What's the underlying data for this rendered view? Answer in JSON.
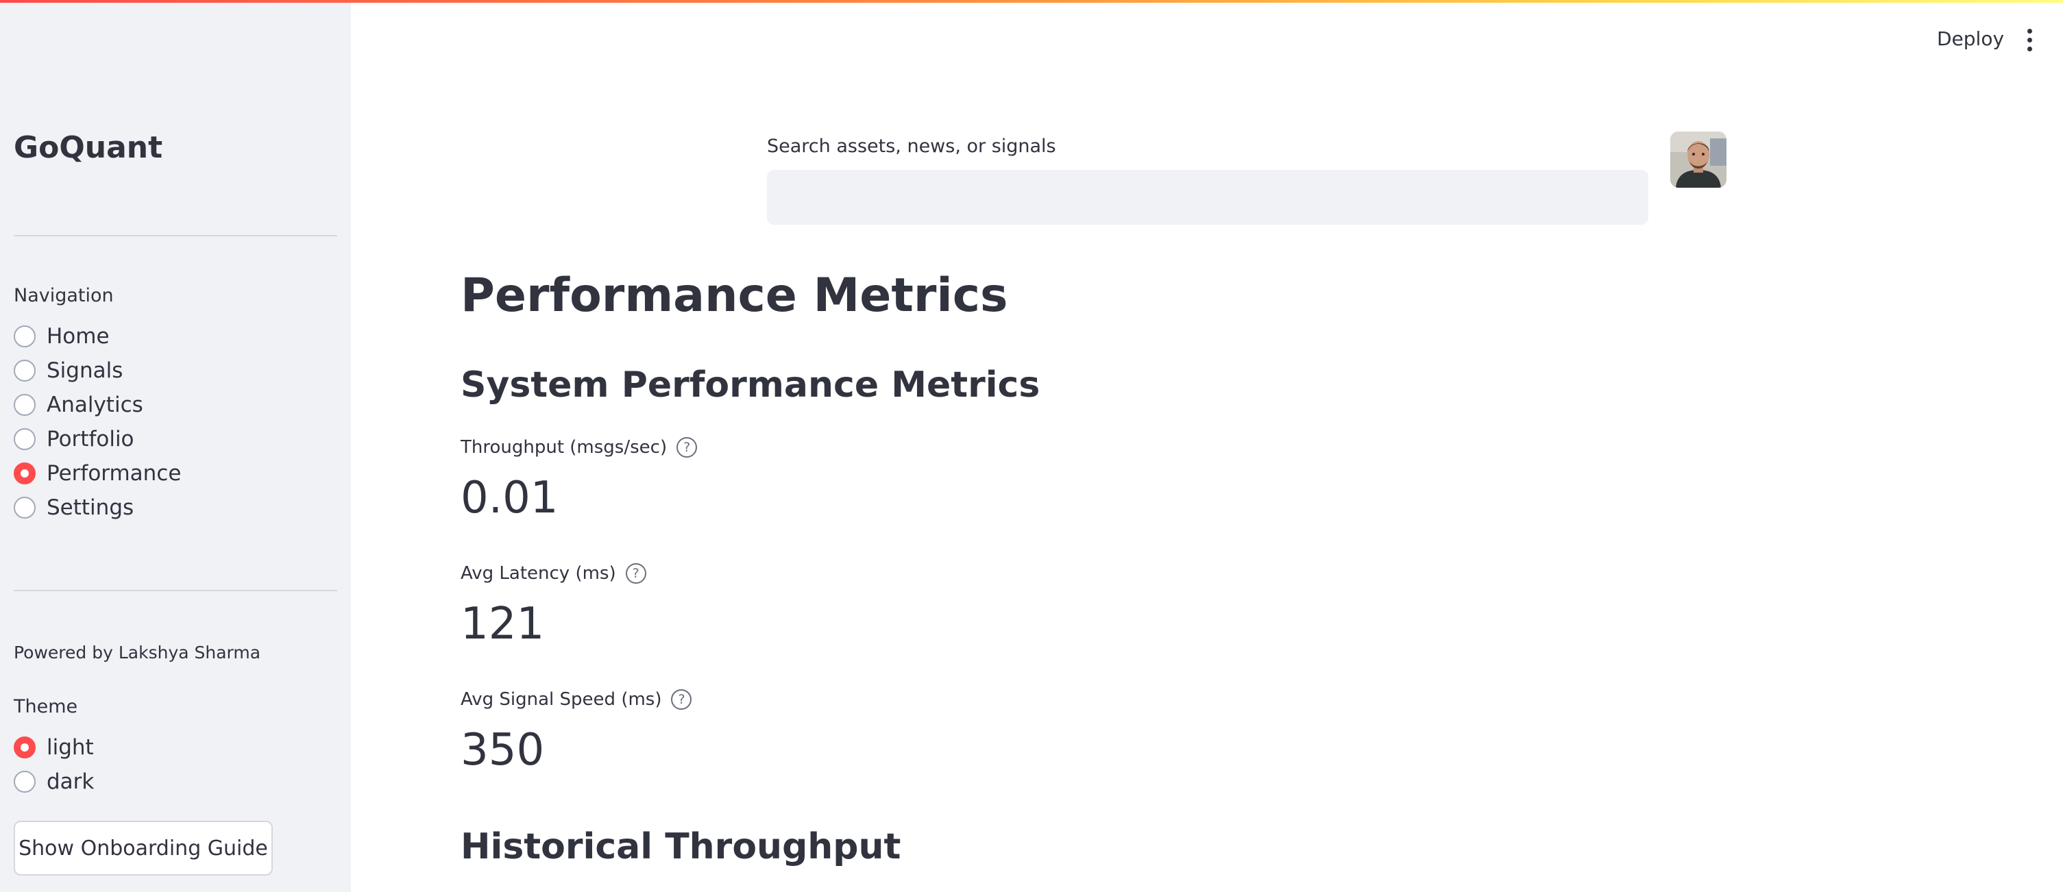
{
  "colors": {
    "accent": "#ff4b4b",
    "sidebar_bg": "#f0f2f6",
    "text": "#31333f"
  },
  "sidebar": {
    "brand": "GoQuant",
    "navigation_label": "Navigation",
    "nav_items": [
      {
        "label": "Home",
        "selected": false
      },
      {
        "label": "Signals",
        "selected": false
      },
      {
        "label": "Analytics",
        "selected": false
      },
      {
        "label": "Portfolio",
        "selected": false
      },
      {
        "label": "Performance",
        "selected": true
      },
      {
        "label": "Settings",
        "selected": false
      }
    ],
    "powered_by": "Powered by Lakshya Sharma",
    "theme_label": "Theme",
    "theme_options": [
      {
        "label": "light",
        "selected": true
      },
      {
        "label": "dark",
        "selected": false
      }
    ],
    "onboarding_button": "Show Onboarding Guide"
  },
  "header": {
    "deploy_label": "Deploy",
    "menu_icon": "kebab-menu-icon"
  },
  "search": {
    "label": "Search assets, news, or signals",
    "value": "",
    "placeholder": ""
  },
  "main": {
    "title": "Performance Metrics",
    "system_heading": "System Performance Metrics",
    "metrics": [
      {
        "label": "Throughput (msgs/sec)",
        "value": "0.01"
      },
      {
        "label": "Avg Latency (ms)",
        "value": "121"
      },
      {
        "label": "Avg Signal Speed (ms)",
        "value": "350"
      }
    ],
    "historical_heading": "Historical Throughput"
  }
}
